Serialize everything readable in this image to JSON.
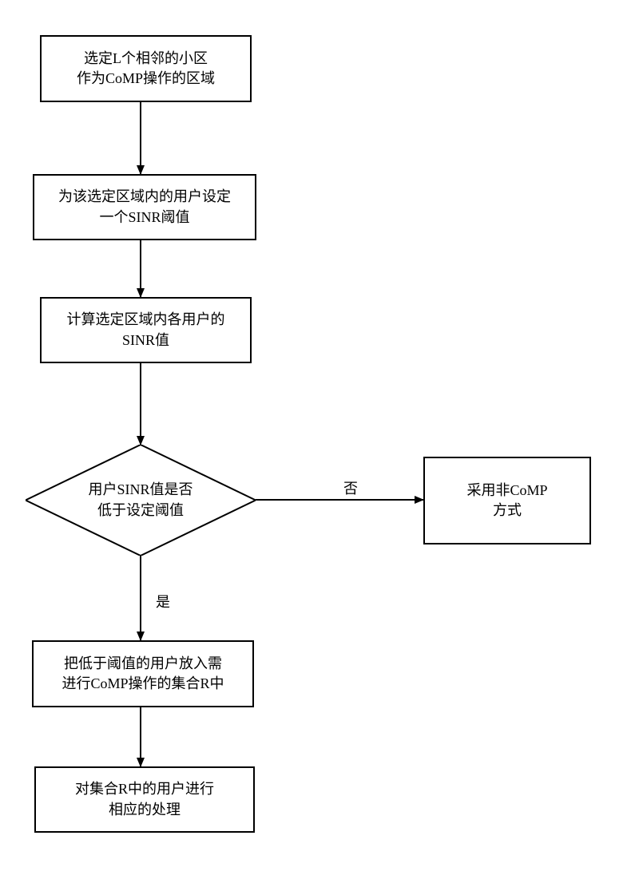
{
  "flowchart": {
    "steps": {
      "step1": "选定L个相邻的小区\n作为CoMP操作的区域",
      "step2": "为该选定区域内的用户设定\n一个SINR阈值",
      "step3": "计算选定区域内各用户的\nSINR值",
      "decision": "用户SINR值是否\n低于设定阈值",
      "step_no": "采用非CoMP\n方式",
      "step_yes1": "把低于阈值的用户放入需\n进行CoMP操作的集合R中",
      "step_yes2": "对集合R中的用户进行\n相应的处理"
    },
    "labels": {
      "no": "否",
      "yes": "是"
    }
  }
}
